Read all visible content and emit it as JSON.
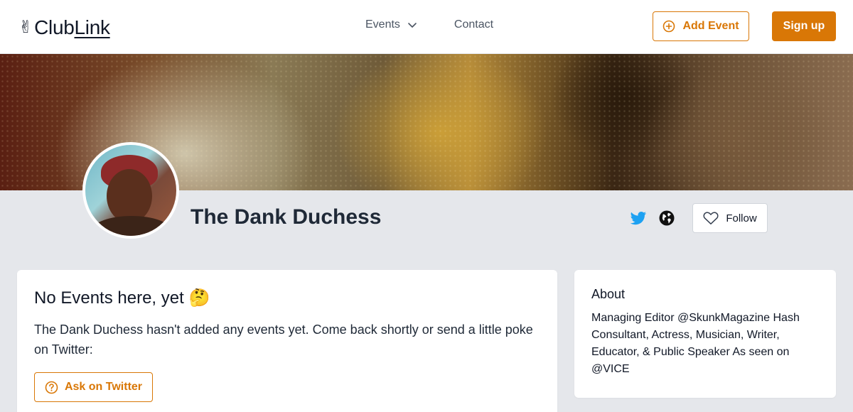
{
  "header": {
    "logo_emoji": "✌",
    "logo_club": "Club",
    "logo_link": "Link",
    "nav": {
      "events_label": "Events",
      "contact_label": "Contact"
    },
    "add_event_label": "Add Event",
    "signup_label": "Sign up"
  },
  "profile": {
    "name": "The Dank Duchess",
    "follow_label": "Follow",
    "icons": [
      "twitter-icon",
      "globe-icon",
      "heart-icon"
    ]
  },
  "events_card": {
    "title": "No Events here, yet 🤔",
    "message": "The Dank Duchess hasn't added any events yet. Come back shortly or send a little poke on Twitter:",
    "ask_button_label": "Ask on Twitter"
  },
  "about_card": {
    "title": "About",
    "text": "Managing Editor @SkunkMagazine Hash Consultant, Actress, Musician, Writer, Educator, & Public Speaker As seen on @VICE"
  },
  "colors": {
    "accent": "#d97706",
    "twitter": "#1da1f2",
    "page_bg": "#e5e7eb"
  }
}
